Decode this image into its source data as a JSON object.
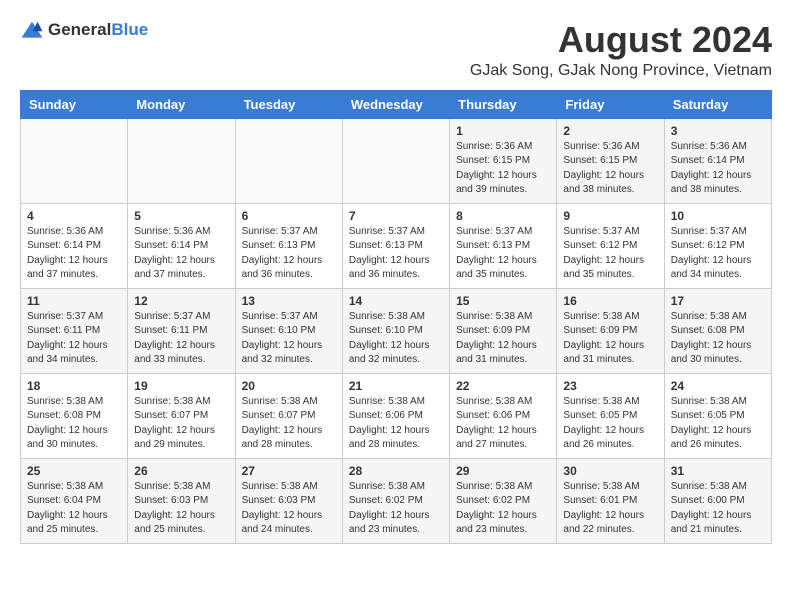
{
  "header": {
    "logo_general": "General",
    "logo_blue": "Blue",
    "month_title": "August 2024",
    "location": "GJak Song, GJak Nong Province, Vietnam"
  },
  "weekdays": [
    "Sunday",
    "Monday",
    "Tuesday",
    "Wednesday",
    "Thursday",
    "Friday",
    "Saturday"
  ],
  "weeks": [
    {
      "days": [
        {
          "number": "",
          "info": ""
        },
        {
          "number": "",
          "info": ""
        },
        {
          "number": "",
          "info": ""
        },
        {
          "number": "",
          "info": ""
        },
        {
          "number": "1",
          "info": "Sunrise: 5:36 AM\nSunset: 6:15 PM\nDaylight: 12 hours\nand 39 minutes."
        },
        {
          "number": "2",
          "info": "Sunrise: 5:36 AM\nSunset: 6:15 PM\nDaylight: 12 hours\nand 38 minutes."
        },
        {
          "number": "3",
          "info": "Sunrise: 5:36 AM\nSunset: 6:14 PM\nDaylight: 12 hours\nand 38 minutes."
        }
      ]
    },
    {
      "days": [
        {
          "number": "4",
          "info": "Sunrise: 5:36 AM\nSunset: 6:14 PM\nDaylight: 12 hours\nand 37 minutes."
        },
        {
          "number": "5",
          "info": "Sunrise: 5:36 AM\nSunset: 6:14 PM\nDaylight: 12 hours\nand 37 minutes."
        },
        {
          "number": "6",
          "info": "Sunrise: 5:37 AM\nSunset: 6:13 PM\nDaylight: 12 hours\nand 36 minutes."
        },
        {
          "number": "7",
          "info": "Sunrise: 5:37 AM\nSunset: 6:13 PM\nDaylight: 12 hours\nand 36 minutes."
        },
        {
          "number": "8",
          "info": "Sunrise: 5:37 AM\nSunset: 6:13 PM\nDaylight: 12 hours\nand 35 minutes."
        },
        {
          "number": "9",
          "info": "Sunrise: 5:37 AM\nSunset: 6:12 PM\nDaylight: 12 hours\nand 35 minutes."
        },
        {
          "number": "10",
          "info": "Sunrise: 5:37 AM\nSunset: 6:12 PM\nDaylight: 12 hours\nand 34 minutes."
        }
      ]
    },
    {
      "days": [
        {
          "number": "11",
          "info": "Sunrise: 5:37 AM\nSunset: 6:11 PM\nDaylight: 12 hours\nand 34 minutes."
        },
        {
          "number": "12",
          "info": "Sunrise: 5:37 AM\nSunset: 6:11 PM\nDaylight: 12 hours\nand 33 minutes."
        },
        {
          "number": "13",
          "info": "Sunrise: 5:37 AM\nSunset: 6:10 PM\nDaylight: 12 hours\nand 32 minutes."
        },
        {
          "number": "14",
          "info": "Sunrise: 5:38 AM\nSunset: 6:10 PM\nDaylight: 12 hours\nand 32 minutes."
        },
        {
          "number": "15",
          "info": "Sunrise: 5:38 AM\nSunset: 6:09 PM\nDaylight: 12 hours\nand 31 minutes."
        },
        {
          "number": "16",
          "info": "Sunrise: 5:38 AM\nSunset: 6:09 PM\nDaylight: 12 hours\nand 31 minutes."
        },
        {
          "number": "17",
          "info": "Sunrise: 5:38 AM\nSunset: 6:08 PM\nDaylight: 12 hours\nand 30 minutes."
        }
      ]
    },
    {
      "days": [
        {
          "number": "18",
          "info": "Sunrise: 5:38 AM\nSunset: 6:08 PM\nDaylight: 12 hours\nand 30 minutes."
        },
        {
          "number": "19",
          "info": "Sunrise: 5:38 AM\nSunset: 6:07 PM\nDaylight: 12 hours\nand 29 minutes."
        },
        {
          "number": "20",
          "info": "Sunrise: 5:38 AM\nSunset: 6:07 PM\nDaylight: 12 hours\nand 28 minutes."
        },
        {
          "number": "21",
          "info": "Sunrise: 5:38 AM\nSunset: 6:06 PM\nDaylight: 12 hours\nand 28 minutes."
        },
        {
          "number": "22",
          "info": "Sunrise: 5:38 AM\nSunset: 6:06 PM\nDaylight: 12 hours\nand 27 minutes."
        },
        {
          "number": "23",
          "info": "Sunrise: 5:38 AM\nSunset: 6:05 PM\nDaylight: 12 hours\nand 26 minutes."
        },
        {
          "number": "24",
          "info": "Sunrise: 5:38 AM\nSunset: 6:05 PM\nDaylight: 12 hours\nand 26 minutes."
        }
      ]
    },
    {
      "days": [
        {
          "number": "25",
          "info": "Sunrise: 5:38 AM\nSunset: 6:04 PM\nDaylight: 12 hours\nand 25 minutes."
        },
        {
          "number": "26",
          "info": "Sunrise: 5:38 AM\nSunset: 6:03 PM\nDaylight: 12 hours\nand 25 minutes."
        },
        {
          "number": "27",
          "info": "Sunrise: 5:38 AM\nSunset: 6:03 PM\nDaylight: 12 hours\nand 24 minutes."
        },
        {
          "number": "28",
          "info": "Sunrise: 5:38 AM\nSunset: 6:02 PM\nDaylight: 12 hours\nand 23 minutes."
        },
        {
          "number": "29",
          "info": "Sunrise: 5:38 AM\nSunset: 6:02 PM\nDaylight: 12 hours\nand 23 minutes."
        },
        {
          "number": "30",
          "info": "Sunrise: 5:38 AM\nSunset: 6:01 PM\nDaylight: 12 hours\nand 22 minutes."
        },
        {
          "number": "31",
          "info": "Sunrise: 5:38 AM\nSunset: 6:00 PM\nDaylight: 12 hours\nand 21 minutes."
        }
      ]
    }
  ]
}
